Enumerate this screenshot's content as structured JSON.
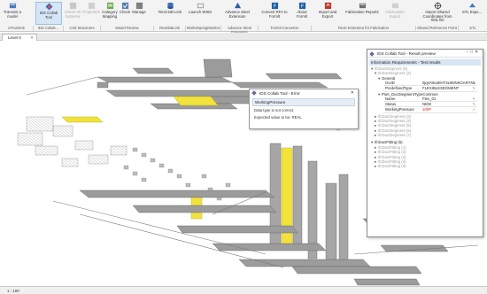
{
  "ribbon": {
    "buttons": [
      {
        "label": "Transmit a model",
        "icon": "transmit-icon"
      },
      {
        "label": "IDS Collab Tool",
        "icon": "ids-collab-icon"
      },
      {
        "label": "Check All Systems",
        "icon": "check-systems-icon"
      },
      {
        "label": "Properties",
        "icon": "properties-icon"
      },
      {
        "label": "Category Mapping",
        "icon": "category-mapping-icon"
      },
      {
        "label": "Check",
        "icon": "check-icon"
      },
      {
        "label": "Manage",
        "icon": "manage-icon"
      },
      {
        "label": "Revit DB Link",
        "icon": "revit-db-link-icon"
      },
      {
        "label": "Launch WSM",
        "icon": "launch-wsm-icon"
      },
      {
        "label": "Advance Steel Extension",
        "icon": "advance-steel-icon"
      },
      {
        "label": "Convert RFA to Formlt",
        "icon": "convert-rfa-icon"
      },
      {
        "label": "About Formlt",
        "icon": "about-formit-icon"
      },
      {
        "label": "Import and Export",
        "icon": "import-export-icon"
      },
      {
        "label": "Fabrication Reports",
        "icon": "fabrication-reports-icon"
      },
      {
        "label": "Fabrication Export",
        "icon": "fabrication-export-icon"
      },
      {
        "label": "Import Shared Coordinates from XML file",
        "icon": "import-coords-icon"
      },
      {
        "label": "STL Expo...",
        "icon": "stl-export-icon"
      }
    ],
    "groups": [
      "eTransmit",
      "IDS Collab...",
      "Civil Structures",
      "Model Review",
      "RevitDBLink",
      "WorksharingMonitor",
      "Advance Steel Extension",
      "FormIt Converter",
      "Revit Extension for Fabrication",
      "Shared Reference Point",
      "STL"
    ]
  },
  "view_tab": {
    "label": "Level 0"
  },
  "status_bar": {
    "scale": "1 : 100"
  },
  "error_dialog": {
    "title": "IDS Collab Tool - Error",
    "field": "WorkingPressure",
    "messages": [
      "Data type is not correct.",
      "Expected value to be: REAL"
    ]
  },
  "result_panel": {
    "title": "IDS Collab Tool - Result preview",
    "section_title": "Information Requirements - Test results",
    "tree": [
      {
        "label": "IfcDuctSegment (9)",
        "level": 0,
        "expanded": true,
        "grey": true
      },
      {
        "label": "IfcDuctSegment (2)",
        "level": 1,
        "expanded": true,
        "grey": true
      },
      {
        "label": "General",
        "level": 2,
        "expanded": true,
        "grey": false
      }
    ],
    "general_props": [
      {
        "key": "GUID",
        "value": "0jqVA8LMiHT3L8NNKOARYN1"
      },
      {
        "key": "PredefinedType",
        "value": "FLEXIBLESEGMENT"
      }
    ],
    "pset_label": "Pset_DuctSegmentTypeCommon",
    "pset_props": [
      {
        "key": "Name",
        "value": "Flex_01",
        "error": false
      },
      {
        "key": "Status",
        "value": "NEW",
        "error": false
      },
      {
        "key": "WorkingPressure",
        "value": "10hP",
        "error": true
      }
    ],
    "tree_after": [
      {
        "label": "IfcDuctSegment (3)",
        "level": 1,
        "grey": true
      },
      {
        "label": "IfcDuctSegment (4)",
        "level": 1,
        "grey": true
      },
      {
        "label": "IfcDuctSegment (5)",
        "level": 1,
        "grey": true
      },
      {
        "label": "IfcDuctSegment (6)",
        "level": 1,
        "grey": true
      },
      {
        "label": "IfcDuctSegment (7)",
        "level": 1,
        "grey": true
      },
      {
        "label": "IfcDuctFitting (5)",
        "level": 0,
        "grey": false
      },
      {
        "label": "IfcDuctFitting (1)",
        "level": 1,
        "grey": true
      },
      {
        "label": "IfcDuctFitting (2)",
        "level": 1,
        "grey": true
      },
      {
        "label": "IfcDuctFitting (3)",
        "level": 1,
        "grey": true
      },
      {
        "label": "IfcDuctFitting (4)",
        "level": 1,
        "grey": true
      },
      {
        "label": "IfcDuctFitting (5)",
        "level": 1,
        "grey": true
      }
    ]
  },
  "colors": {
    "highlight": "#f2e23c",
    "accent": "#2e6fbf",
    "error": "#d02020",
    "duct": "#8a8a8a"
  }
}
